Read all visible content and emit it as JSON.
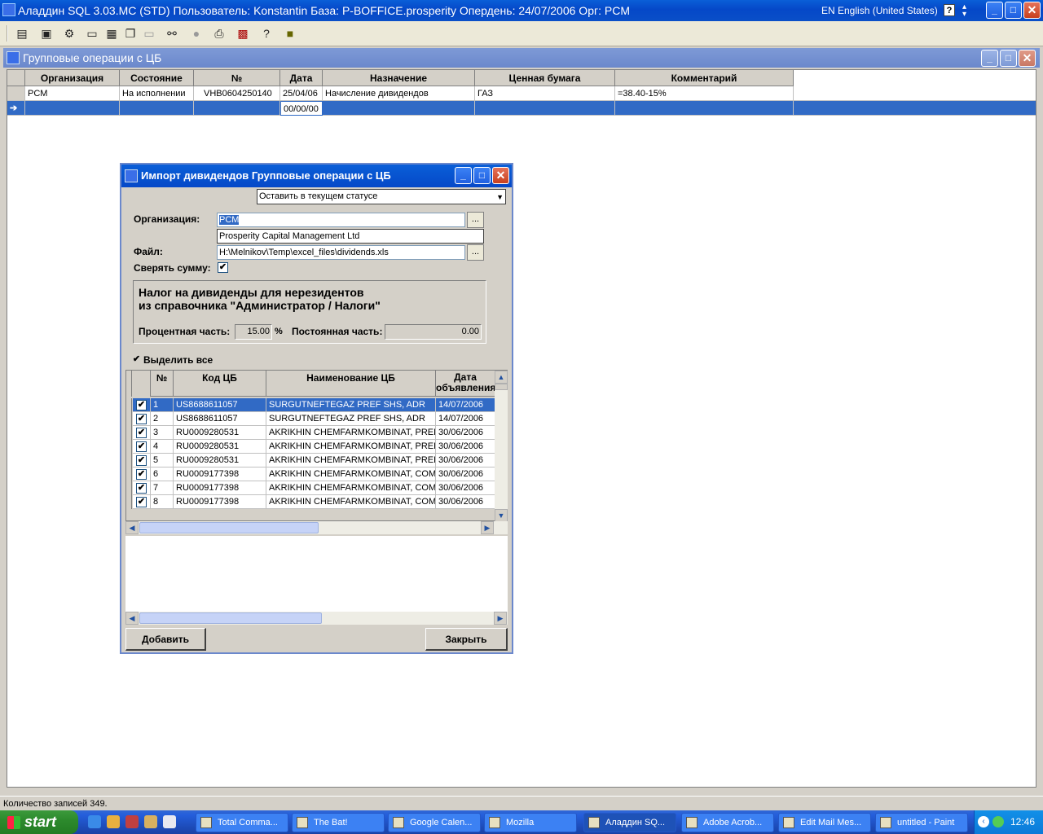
{
  "app": {
    "title": "Аладдин SQL 3.03.MC (STD)  Пользователь: Konstantin База: P-BOFFICE.prosperity Опердень: 24/07/2006 Орг: PCM",
    "language": "EN English (United States)",
    "help_glyph": "?"
  },
  "window_buttons": {
    "minimize": "_",
    "maximize": "□",
    "close": "✕"
  },
  "toolbar": {
    "icons": [
      "report-icon",
      "bucket-icon",
      "wizard-icon",
      "window-icon",
      "tile-icon",
      "cascade-icon",
      "minimize-window-icon",
      "binoculars-icon",
      "stop-icon",
      "print-icon",
      "export-icon",
      "help-icon",
      "exit-icon"
    ]
  },
  "mdi": {
    "title": "Групповые операции с ЦБ",
    "columns": [
      "Организация",
      "Состояние",
      "№",
      "Дата",
      "Назначение",
      "Ценная бумага",
      "Комментарий"
    ],
    "rows": [
      [
        "PCM",
        "На исполнении",
        "VHB0604250140",
        "25/04/06",
        "Начисление дивидендов",
        "ГАЗ",
        "=38.40-15%"
      ],
      [
        "",
        "",
        "",
        "00/00/00",
        "",
        "",
        ""
      ]
    ],
    "row_pointer": "➔"
  },
  "dialog": {
    "title": "Импорт дивидендов Групповые операции с ЦБ",
    "status_select": "Оставить в текущем статусе",
    "org_label": "Организация:",
    "org_value": "PCM",
    "org_name": "Prosperity Capital Management Ltd",
    "file_label": "Файл:",
    "file_value": "H:\\Melnikov\\Temp\\excel_files\\dividends.xls",
    "browse_label": "...",
    "check_sum_label": "Сверять сумму:",
    "tax_title_line1": "Налог на дивиденды для нерезидентов",
    "tax_title_line2": "из справочника \"Администратор / Налоги\"",
    "percent_label": "Процентная часть:",
    "percent_value": "15.00",
    "percent_unit": "%",
    "fixed_label": "Постоянная часть:",
    "fixed_value": "0.00",
    "select_all_label": "Выделить все",
    "grid_headers": [
      "№",
      "Код ЦБ",
      "Наименование ЦБ",
      "Дата объявления"
    ],
    "grid_rows": [
      {
        "n": "1",
        "code": "US8688611057",
        "name": "SURGUTNEFTEGAZ PREF SHS, ADR",
        "date": "14/07/2006"
      },
      {
        "n": "2",
        "code": "US8688611057",
        "name": "SURGUTNEFTEGAZ PREF SHS, ADR",
        "date": "14/07/2006"
      },
      {
        "n": "3",
        "code": "RU0009280531",
        "name": "AKRIKHIN CHEMFARMKOMBINAT, PREF",
        "date": "30/06/2006"
      },
      {
        "n": "4",
        "code": "RU0009280531",
        "name": "AKRIKHIN CHEMFARMKOMBINAT, PREF",
        "date": "30/06/2006"
      },
      {
        "n": "5",
        "code": "RU0009280531",
        "name": "AKRIKHIN CHEMFARMKOMBINAT, PREF",
        "date": "30/06/2006"
      },
      {
        "n": "6",
        "code": "RU0009177398",
        "name": "AKRIKHIN CHEMFARMKOMBINAT, COM",
        "date": "30/06/2006"
      },
      {
        "n": "7",
        "code": "RU0009177398",
        "name": "AKRIKHIN CHEMFARMKOMBINAT, COM",
        "date": "30/06/2006"
      },
      {
        "n": "8",
        "code": "RU0009177398",
        "name": "AKRIKHIN CHEMFARMKOMBINAT, COM",
        "date": "30/06/2006"
      }
    ],
    "add_button": "Добавить",
    "close_button": "Закрыть"
  },
  "status_bar": "Количество записей 349.",
  "taskbar": {
    "start": "start",
    "tasks": [
      "Total Comma...",
      "The Bat!",
      "Google Calen...",
      "Mozilla",
      "Аладдин SQ...",
      "Adobe Acrob...",
      "Edit Mail Mes...",
      "untitled - Paint"
    ],
    "clock": "12:46"
  },
  "colors": {
    "selection": "#316ac5",
    "xp_blue": "#0548c8",
    "mdi_inactive": "#6b88cc"
  }
}
